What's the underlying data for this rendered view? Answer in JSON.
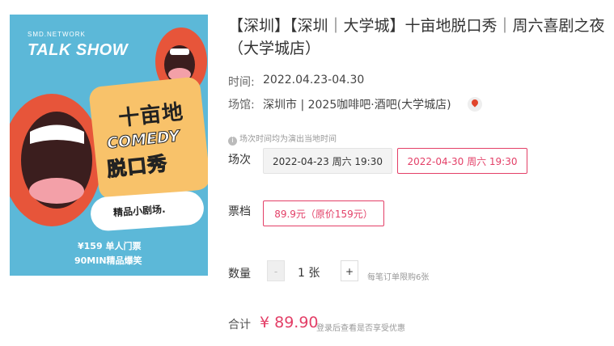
{
  "poster": {
    "brand": "SMD.NETWORK",
    "show": "TALK SHOW",
    "line1": "十亩地",
    "line2": "COMEDY",
    "line3": "脱口秀",
    "pill": "精品小剧场.",
    "foot1": "¥159 单人门票",
    "foot2": "90MIN精品爆笑",
    "colors": {
      "bg": "#5cb8d8",
      "bubble": "#f8c26a",
      "lips": "#e7553a"
    }
  },
  "event": {
    "title": "【深圳】【深圳｜大学城】十亩地脱口秀｜周六喜剧之夜（大学城店）",
    "time_label": "时间:",
    "time_value": "2022.04.23-04.30",
    "venue_label": "场馆:",
    "venue_value": "深圳市 | 2025咖啡吧·酒吧(大学城店)",
    "notice": "场次时间均为演出当地时间"
  },
  "session": {
    "label": "场次",
    "options": [
      "2022-04-23 周六 19:30",
      "2022-04-30 周六 19:30"
    ]
  },
  "tier": {
    "label": "票档",
    "option": "89.9元（原价159元）"
  },
  "quantity": {
    "label": "数量",
    "minus": "-",
    "value": "1 张",
    "plus": "+",
    "note": "每笔订单限购6张"
  },
  "total": {
    "label": "合计",
    "price": "¥ 89.90",
    "note": "登录后查看是否享受优惠"
  },
  "colors": {
    "accent": "#e33f67"
  },
  "icons": {
    "map": "map-pin-icon",
    "info": "info-icon"
  }
}
